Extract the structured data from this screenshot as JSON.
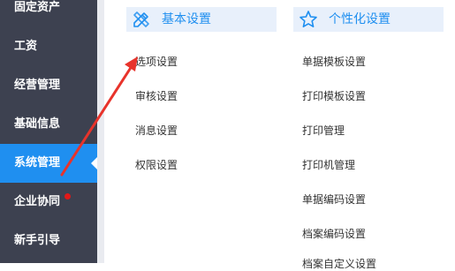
{
  "sidebar": {
    "items": [
      {
        "label": "固定资产"
      },
      {
        "label": "工资"
      },
      {
        "label": "经营管理"
      },
      {
        "label": "基础信息"
      },
      {
        "label": "系统管理"
      },
      {
        "label": "企业协同"
      },
      {
        "label": "新手引导"
      }
    ]
  },
  "basic_settings": {
    "title": "基本设置",
    "icon": "pencil-ruler-icon",
    "items": [
      {
        "label": "选项设置"
      },
      {
        "label": "审核设置"
      },
      {
        "label": "消息设置"
      },
      {
        "label": "权限设置"
      }
    ]
  },
  "personalization": {
    "title": "个性化设置",
    "icon": "star-icon",
    "items": [
      {
        "label": "单据模板设置"
      },
      {
        "label": "打印模板设置"
      },
      {
        "label": "打印管理"
      },
      {
        "label": "打印机管理"
      },
      {
        "label": "单据编码设置"
      },
      {
        "label": "档案编码设置"
      },
      {
        "label": "档案自定义设置"
      }
    ]
  },
  "colors": {
    "sidebar_bg": "#3d4150",
    "active_bg": "#1f8ff0",
    "accent": "#1f8ff0",
    "header_bg": "#e8f0fb",
    "notification_dot": "#e11818",
    "annotation_arrow": "#e8332b"
  }
}
